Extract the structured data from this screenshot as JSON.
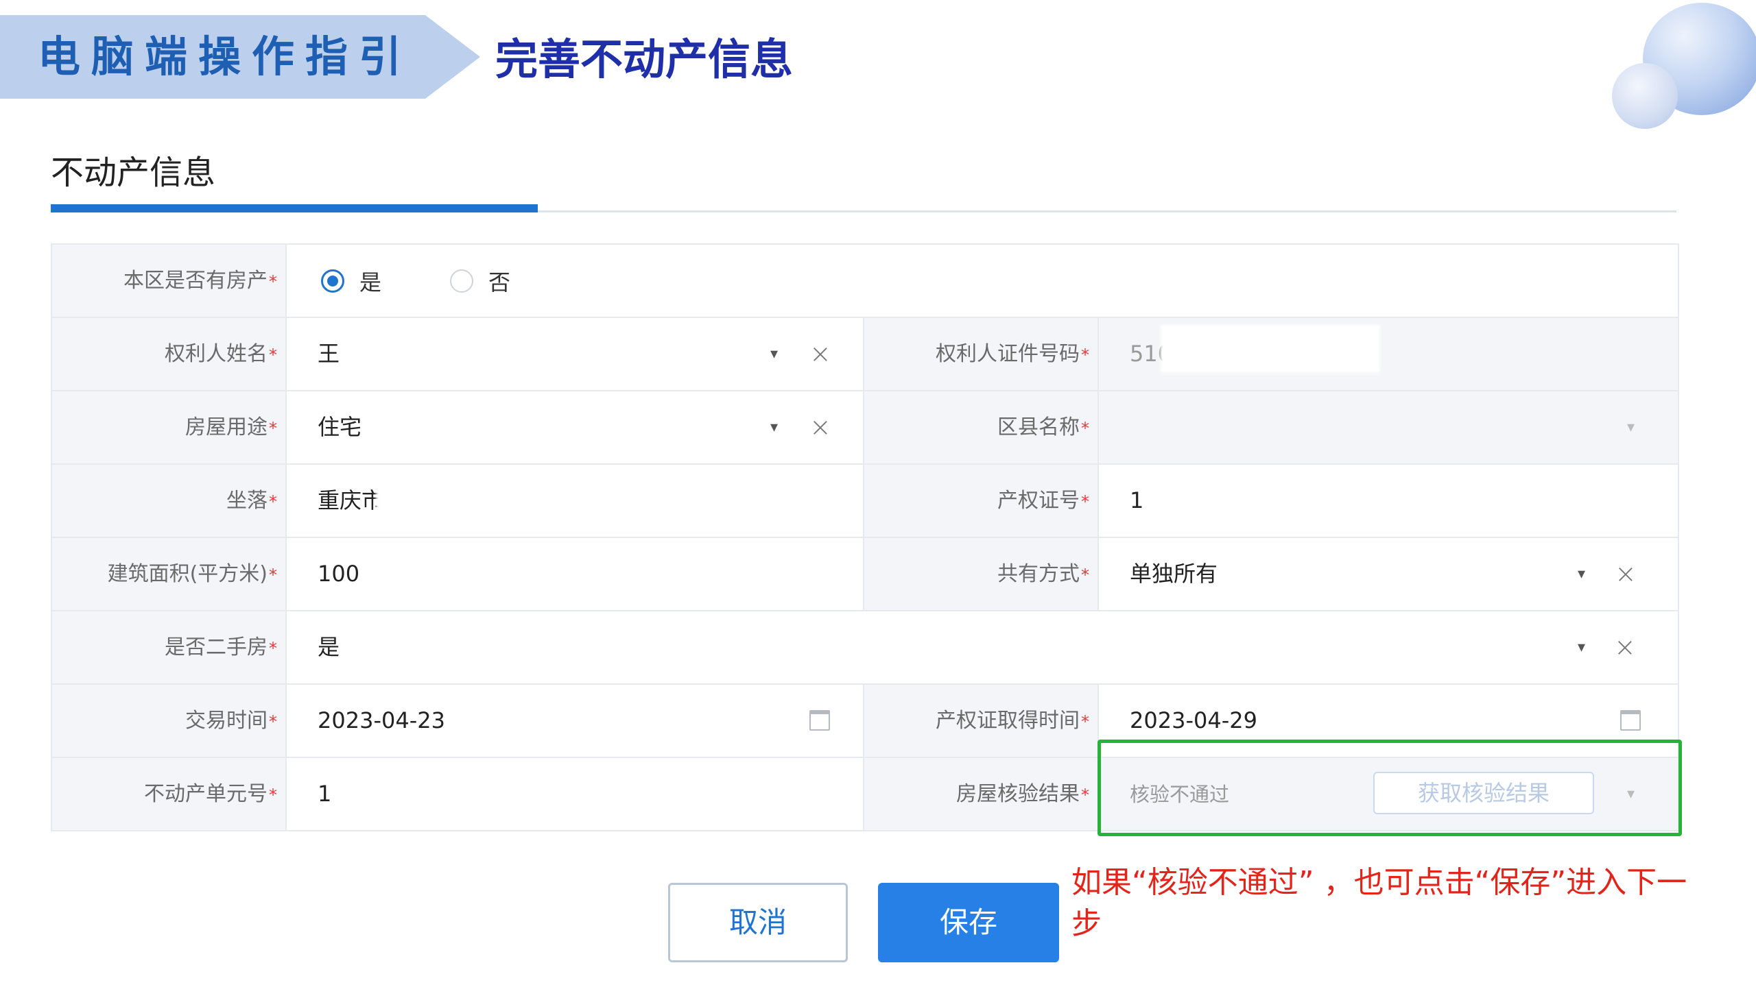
{
  "header": {
    "banner_text": "电脑端操作指引",
    "slide_title": "完善不动产信息"
  },
  "section": {
    "title": "不动产信息"
  },
  "form": {
    "has_property": {
      "label": "本区是否有房产",
      "options": [
        "是",
        "否"
      ],
      "selected": "是"
    },
    "owner_name": {
      "label": "权利人姓名",
      "value": "王"
    },
    "owner_id": {
      "label": "权利人证件号码",
      "value": "510"
    },
    "house_usage": {
      "label": "房屋用途",
      "value": "住宅"
    },
    "district": {
      "label": "区县名称",
      "value": ""
    },
    "location": {
      "label": "坐落",
      "value": "重庆市"
    },
    "cert_no": {
      "label": "产权证号",
      "value": "1"
    },
    "area": {
      "label": "建筑面积(平方米)",
      "value": "100"
    },
    "ownership": {
      "label": "共有方式",
      "value": "单独所有"
    },
    "second_hand": {
      "label": "是否二手房",
      "value": "是"
    },
    "trade_date": {
      "label": "交易时间",
      "value": "2023-04-23"
    },
    "cert_date": {
      "label": "产权证取得时间",
      "value": "2023-04-29"
    },
    "unit_no": {
      "label": "不动产单元号",
      "value": "1"
    },
    "verify_result": {
      "label": "房屋核验结果",
      "value": "核验不通过",
      "fetch_button": "获取核验结果"
    },
    "required_mark": "*"
  },
  "actions": {
    "cancel": "取消",
    "save": "保存"
  },
  "note": "如果“核验不通过” ，也可点击“保存”进入下一步",
  "icons": {
    "dropdown": "▾",
    "clear": "×"
  },
  "colors": {
    "accent": "#2680e6",
    "highlight": "#27b33a",
    "note": "#e1251b",
    "banner": "#bcd0ee",
    "title": "#1f2fa8"
  }
}
